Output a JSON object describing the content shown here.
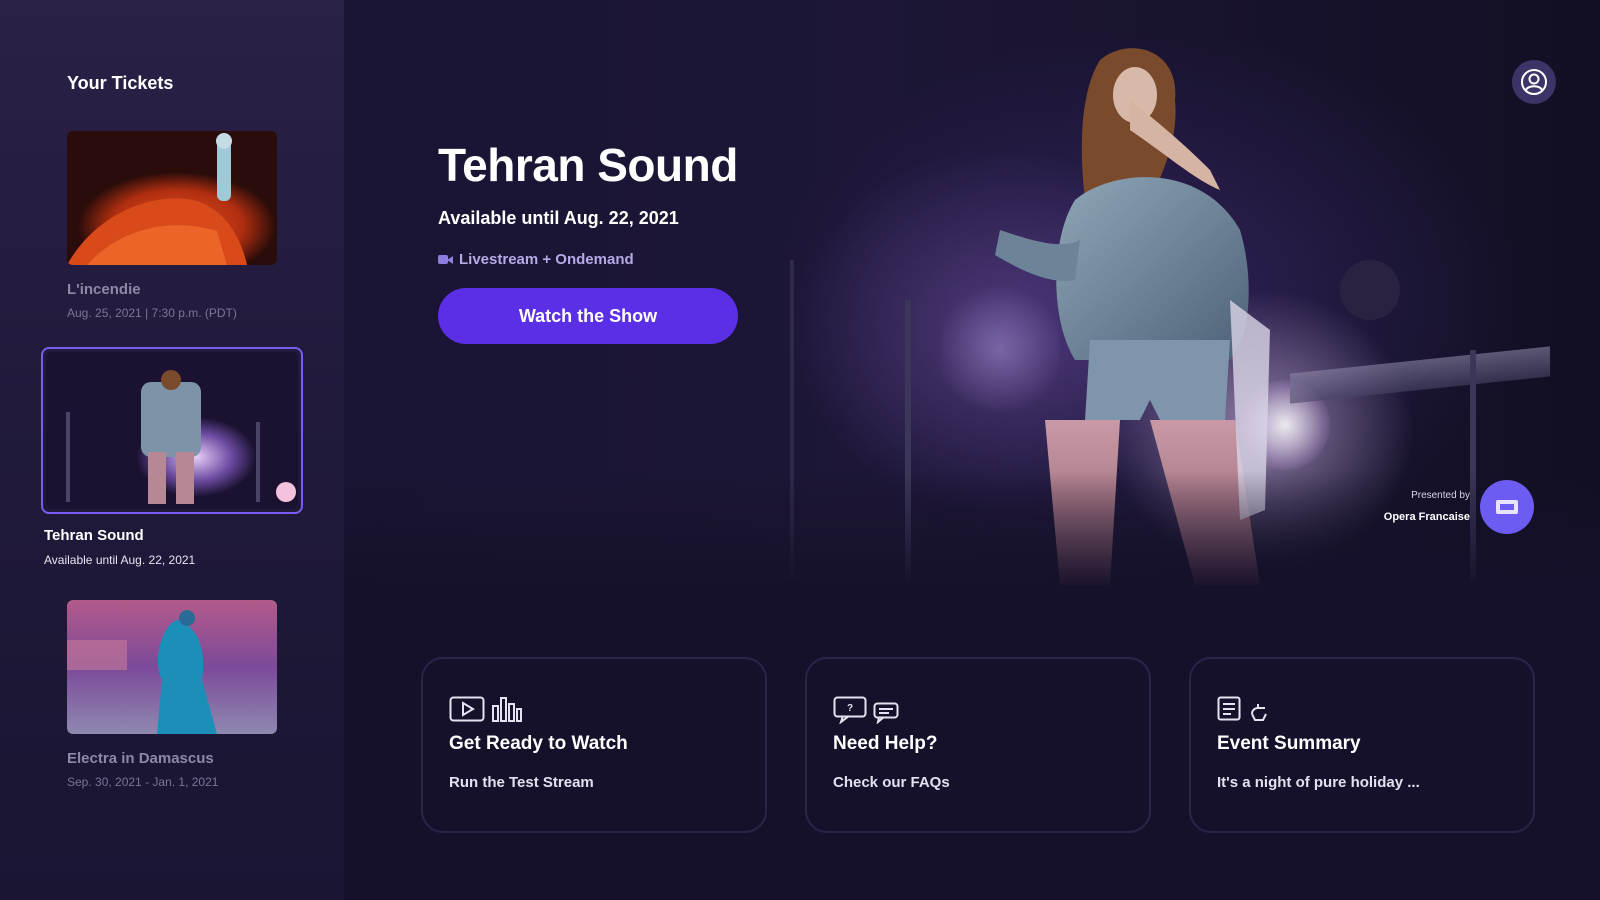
{
  "sidebar": {
    "title": "Your Tickets",
    "tickets": [
      {
        "name": "L'incendie",
        "date": "Aug. 25, 2021 | 7:30 p.m. (PDT)"
      },
      {
        "name": "Tehran Sound",
        "date": "Available until Aug. 22, 2021"
      },
      {
        "name": "Electra in Damascus",
        "date": "Sep. 30, 2021 - Jan. 1, 2021"
      }
    ]
  },
  "hero": {
    "title": "Tehran Sound",
    "availability": "Available until Aug. 22, 2021",
    "format": "Livestream + Ondemand",
    "watch_label": "Watch the Show",
    "presented_by_label": "Presented by",
    "presented_by_org": "Opera Francaise"
  },
  "cards": [
    {
      "title": "Get Ready to Watch",
      "subtitle": "Run the Test Stream",
      "icons": [
        "video-icon",
        "equalizer-icon"
      ]
    },
    {
      "title": "Need Help?",
      "subtitle": "Check our FAQs",
      "icons": [
        "faq-icon",
        "chat-icon"
      ]
    },
    {
      "title": "Event Summary",
      "subtitle": "It's a night of pure holiday ...",
      "icons": [
        "document-icon",
        "hand-icon"
      ]
    }
  ],
  "colors": {
    "background": "#15112a",
    "accent": "#5b2fe6",
    "selected_border": "#7b5cf0"
  }
}
